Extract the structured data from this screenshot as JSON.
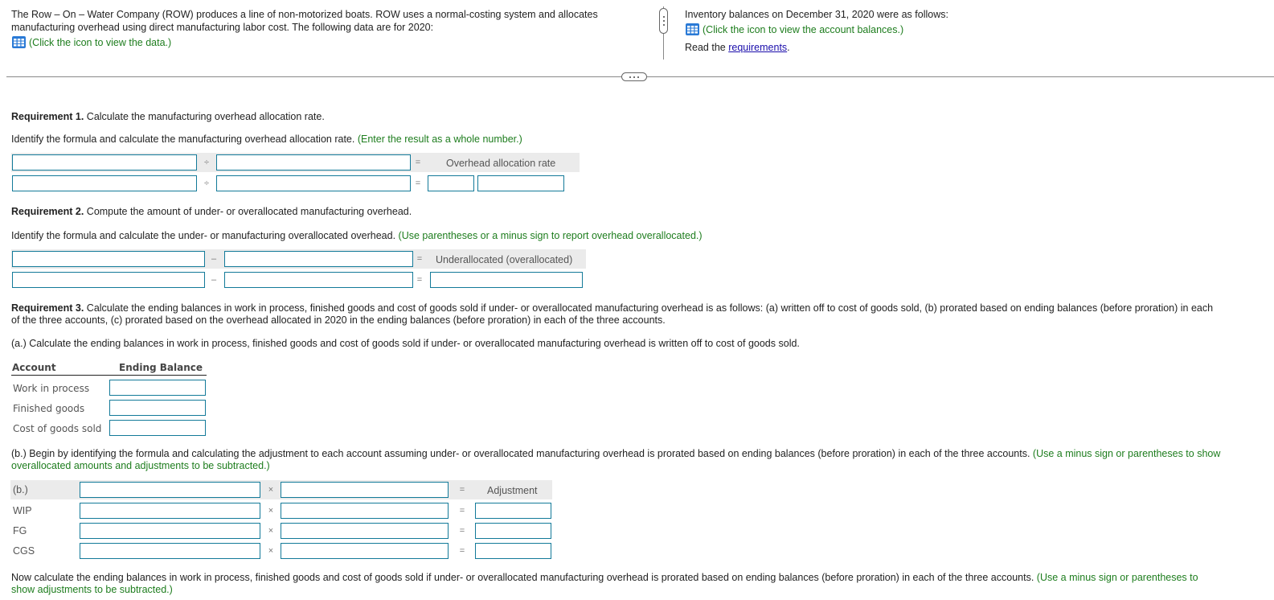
{
  "intro": {
    "line1": "The Row – On – Water Company (ROW) produces a line of non-motorized boats. ROW uses a normal-costing system and allocates",
    "line2": "manufacturing overhead using direct manufacturing labor cost. The following data are for 2020:",
    "data_link": "(Click the icon to view the data.)"
  },
  "right_panel": {
    "inventory_text": "Inventory balances on December 31, 2020 were as follows:",
    "balances_link": "(Click the icon to view the account balances.)",
    "read_prefix": "Read the ",
    "requirements_link": "requirements",
    "read_suffix": "."
  },
  "req1": {
    "heading_bold": "Requirement 1.",
    "heading_text": " Calculate the manufacturing overhead allocation rate.",
    "instruction": "Identify the formula and calculate the manufacturing overhead allocation rate. ",
    "hint": "(Enter the result as a whole number.)",
    "op_divide": "÷",
    "op_equals": "=",
    "result_label": "Overhead allocation rate"
  },
  "req2": {
    "heading_bold": "Requirement 2.",
    "heading_text": " Compute the amount of under- or overallocated manufacturing overhead.",
    "instruction": "Identify the formula and calculate the under- or manufacturing overallocated overhead. ",
    "hint": "(Use parentheses or a minus sign to report overhead overallocated.)",
    "op_minus": "–",
    "op_equals": "=",
    "result_label": "Underallocated (overallocated)"
  },
  "req3": {
    "heading_bold": "Requirement 3.",
    "heading_line1": " Calculate the ending balances in work in process, finished goods and cost of goods sold if under- or overallocated manufacturing overhead is as follows: (a) written off to cost of goods sold, (b) prorated based on ending balances (before proration) in each",
    "heading_line2": "of the three accounts, (c) prorated based on the overhead allocated in 2020 in the ending balances (before proration) in each of the three accounts.",
    "part_a": "(a.) Calculate the ending balances in work in process, finished goods and cost of goods sold if under- or overallocated manufacturing overhead is written off to cost of goods sold.",
    "table_a": {
      "col_account": "Account",
      "col_balance": "Ending Balance",
      "rows": [
        "Work in process",
        "Finished goods",
        "Cost of goods sold"
      ]
    },
    "part_b_line1": "(b.) Begin by identifying the formula and calculating the adjustment to each account assuming under- or overallocated manufacturing overhead is prorated based on ending balances (before proration) in each of the three accounts. ",
    "part_b_hint1": "(Use a minus sign or parentheses to show",
    "part_b_hint2": "overallocated amounts and adjustments to be subtracted.)",
    "table_b": {
      "header_label": "(b.)",
      "op_times": "×",
      "op_equals": "=",
      "result_label": "Adjustment",
      "rows": [
        "WIP",
        "FG",
        "CGS"
      ]
    },
    "now_line1": "Now calculate the ending balances in work in process, finished goods and cost of goods sold if under- or overallocated manufacturing overhead is prorated based on ending balances (before proration) in each of the three accounts. ",
    "now_hint1": "(Use a minus sign or parentheses to",
    "now_hint2": "show adjustments to be subtracted.)"
  }
}
